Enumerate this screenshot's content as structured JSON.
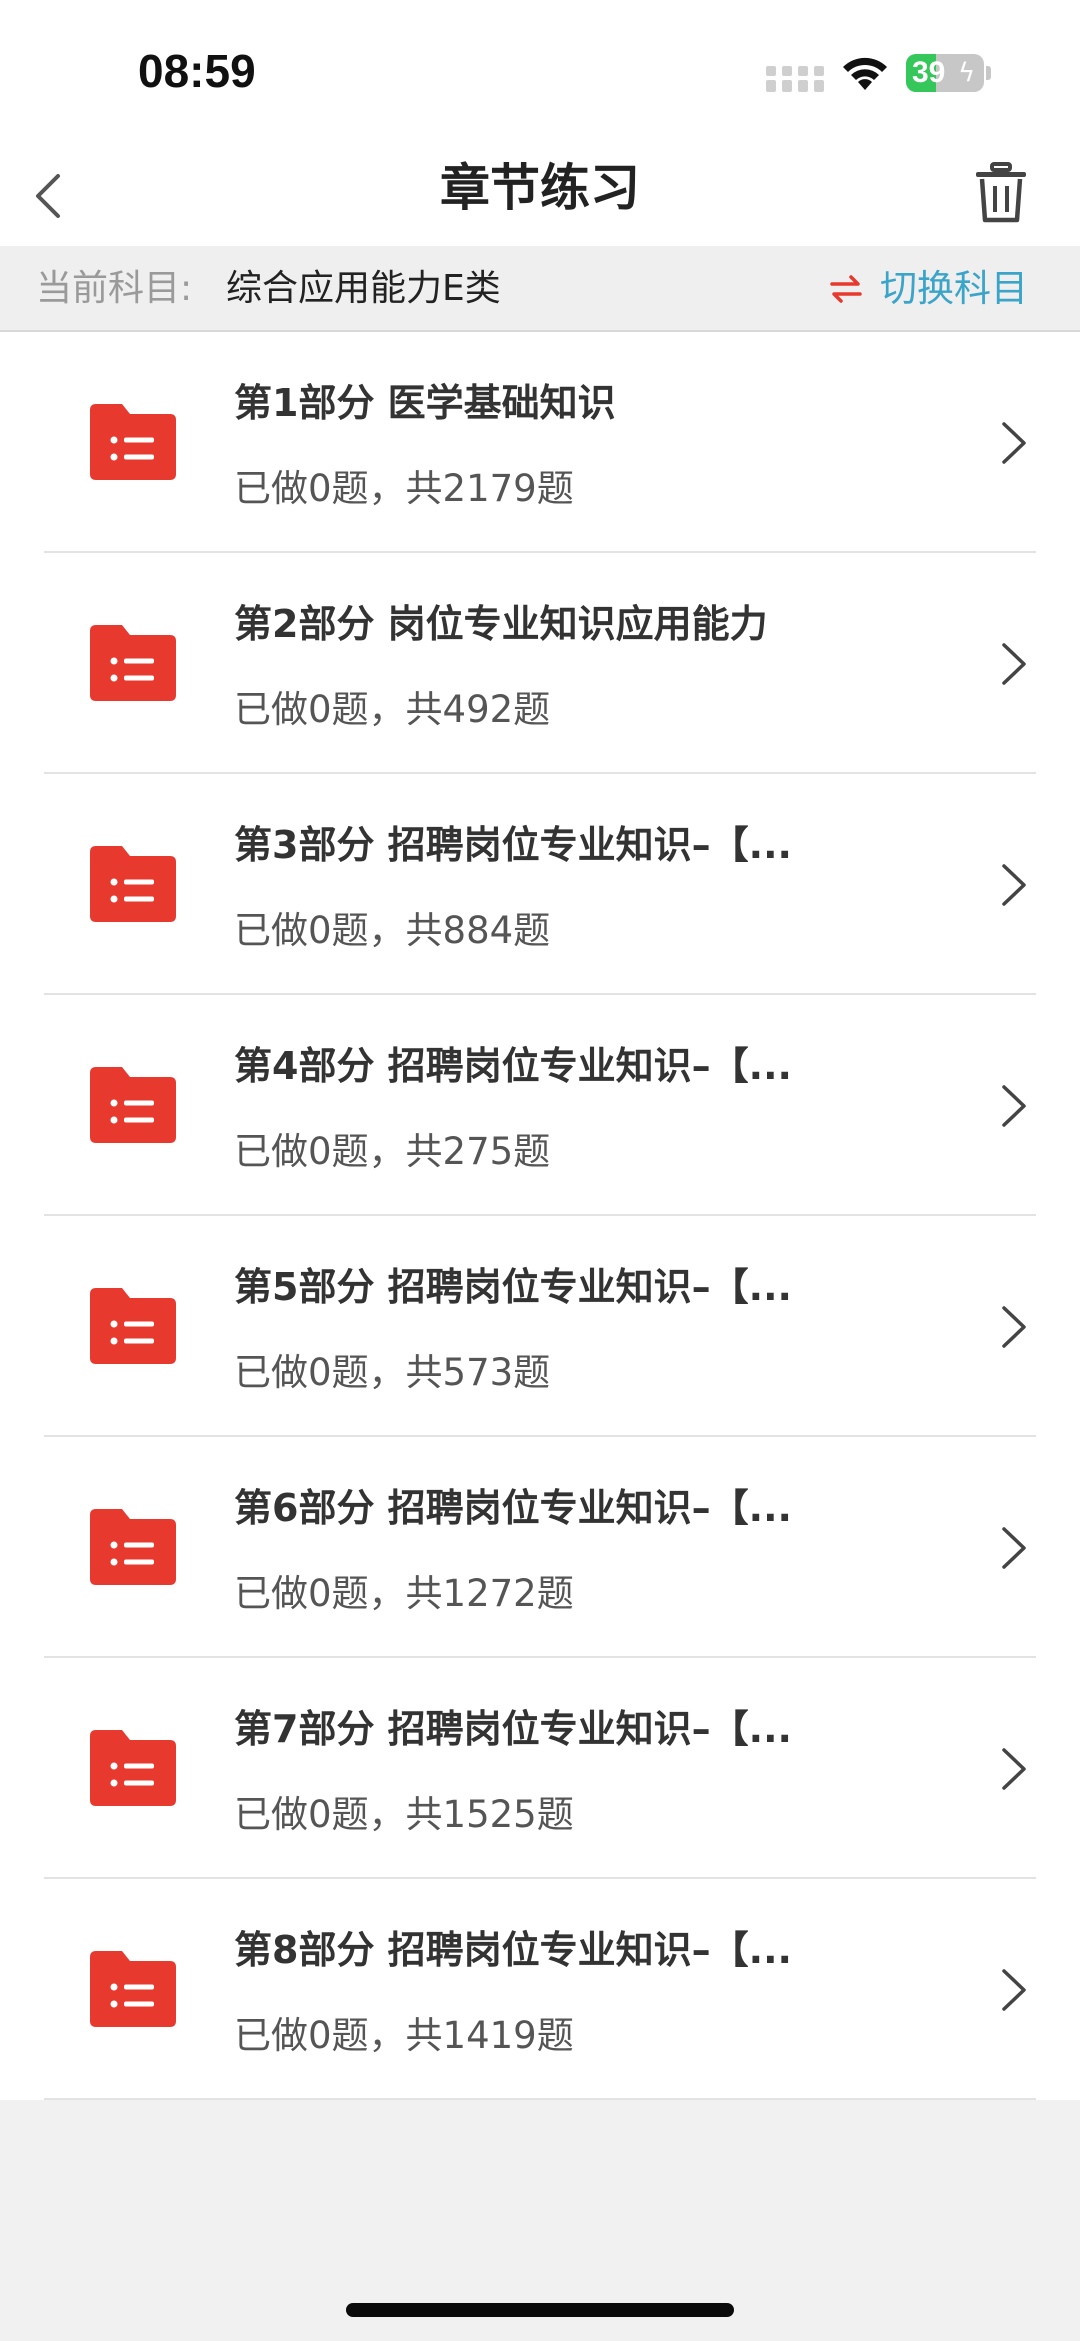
{
  "status_bar": {
    "time": "08:59",
    "battery_level": "39",
    "battery_percent": 39
  },
  "nav": {
    "title": "章节练习"
  },
  "subject_bar": {
    "label": "当前科目:",
    "value": "综合应用能力E类",
    "switch_label": "切换科目"
  },
  "colors": {
    "folder_red": "#e8392f",
    "accent_blue": "#3aa4c9",
    "switch_icon_red": "#e8392f"
  },
  "chapters": [
    {
      "title": "第1部分  医学基础知识",
      "progress": "已做0题，共2179题"
    },
    {
      "title": "第2部分  岗位专业知识应用能力",
      "progress": "已做0题，共492题"
    },
    {
      "title": "第3部分  招聘岗位专业知识–【...",
      "progress": "已做0题，共884题"
    },
    {
      "title": "第4部分  招聘岗位专业知识–【...",
      "progress": "已做0题，共275题"
    },
    {
      "title": "第5部分  招聘岗位专业知识–【...",
      "progress": "已做0题，共573题"
    },
    {
      "title": "第6部分  招聘岗位专业知识–【...",
      "progress": "已做0题，共1272题"
    },
    {
      "title": "第7部分  招聘岗位专业知识–【...",
      "progress": "已做0题，共1525题"
    },
    {
      "title": "第8部分  招聘岗位专业知识–【...",
      "progress": "已做0题，共1419题"
    }
  ]
}
